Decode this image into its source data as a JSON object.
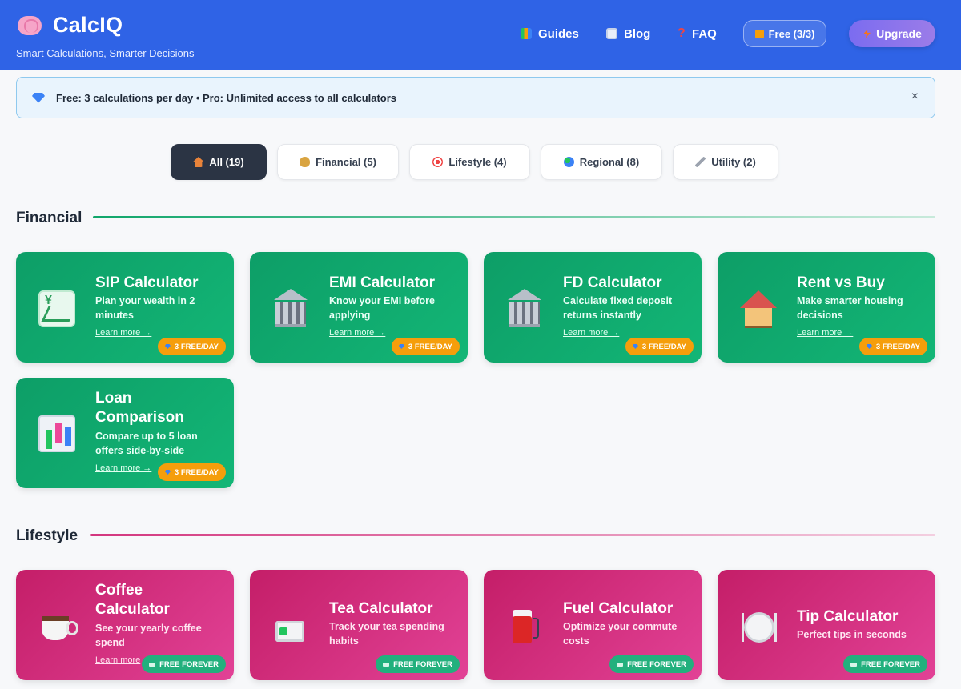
{
  "header": {
    "brand": "CalcIQ",
    "tagline": "Smart Calculations, Smarter Decisions",
    "nav": {
      "guides": "Guides",
      "blog": "Blog",
      "faq": "FAQ"
    },
    "free_pill": "Free (3/3)",
    "upgrade": "Upgrade"
  },
  "banner": {
    "text": "Free: 3 calculations per day • Pro: Unlimited access to all calculators",
    "close": "×"
  },
  "filters": {
    "all": "All (19)",
    "financial": "Financial (5)",
    "lifestyle": "Lifestyle (4)",
    "regional": "Regional (8)",
    "utility": "Utility (2)"
  },
  "sections": {
    "financial": {
      "title": "Financial",
      "cards": [
        {
          "title": "SIP Calculator",
          "desc": "Plan your wealth in 2 minutes",
          "link": "Learn more →",
          "badge": "3 FREE/DAY",
          "icon": "chart-increasing-icon"
        },
        {
          "title": "EMI Calculator",
          "desc": "Know your EMI before applying",
          "link": "Learn more →",
          "badge": "3 FREE/DAY",
          "icon": "bank-icon"
        },
        {
          "title": "FD Calculator",
          "desc": "Calculate fixed deposit returns instantly",
          "link": "Learn more →",
          "badge": "3 FREE/DAY",
          "icon": "bank-icon"
        },
        {
          "title": "Rent vs Buy",
          "desc": "Make smarter housing decisions",
          "link": "Learn more →",
          "badge": "3 FREE/DAY",
          "icon": "house-icon"
        },
        {
          "title": "Loan Comparison",
          "desc": "Compare up to 5 loan offers side-by-side",
          "link": "Learn more →",
          "badge": "3 FREE/DAY",
          "icon": "bar-chart-icon"
        }
      ]
    },
    "lifestyle": {
      "title": "Lifestyle",
      "cards": [
        {
          "title": "Coffee Calculator",
          "desc": "See your yearly coffee spend",
          "link": "Learn more",
          "badge": "FREE FOREVER",
          "icon": "coffee-cup-icon"
        },
        {
          "title": "Tea Calculator",
          "desc": "Track your tea spending habits",
          "link": "",
          "badge": "FREE FOREVER",
          "icon": "tea-icon"
        },
        {
          "title": "Fuel Calculator",
          "desc": "Optimize your commute costs",
          "link": "",
          "badge": "FREE FOREVER",
          "icon": "fuel-pump-icon"
        },
        {
          "title": "Tip Calculator",
          "desc": "Perfect tips in seconds",
          "link": "",
          "badge": "FREE FOREVER",
          "icon": "plate-cutlery-icon"
        }
      ]
    }
  },
  "colors": {
    "header": "#2f63e6",
    "financial": "#0d9e67",
    "lifestyle": "#c41e68",
    "paid_badge": "#f59e0b",
    "free_badge": "#22b07d"
  }
}
